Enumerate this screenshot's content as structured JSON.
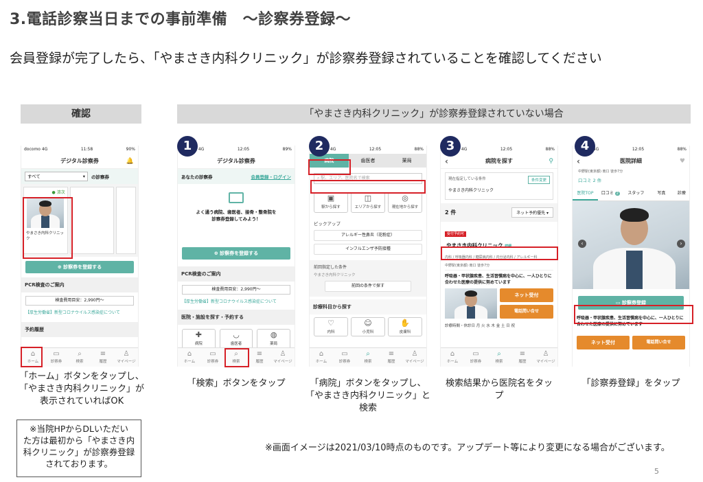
{
  "title": "3.電話診察当日までの事前準備　～診察券登録～",
  "subtitle": "会員登録が完了したら、「やまさき内科クリニック」が診察券登録されていることを確認してください",
  "bars": {
    "confirm": "確認",
    "not_registered": "「やまさき内科クリニック」が診察券登録されていない場合"
  },
  "badges": [
    "1",
    "2",
    "3",
    "4"
  ],
  "phone0": {
    "status_left": "docomo 4G",
    "status_time": "11:58",
    "status_right": "90%",
    "header": "デジタル診察券",
    "filter_value": "すべて",
    "filter_suffix": "の診察券",
    "card_status": "● 済次",
    "card_clinic": "やまさき内科クリニック",
    "register_btn": "⊕ 診察券を登録する",
    "pcr_title": "PCR検査のご案内",
    "pcr_price": "検査費用目安：2,990円～",
    "pcr_link": "【厚生労働省】新型コロナウイルス感染症について",
    "history": "予約履歴"
  },
  "phone1": {
    "status_left": "docomo 4G",
    "status_time": "12:05",
    "status_right": "89%",
    "header": "デジタル診察券",
    "section": "あなたの診察券",
    "login_link": "会員登録・ログイン",
    "prompt": "よく通う病院、歯医者、接骨・整骨院を診察券登録してみよう！",
    "register_btn": "⊕ 診察券を登録する",
    "pcr_title": "PCR検査のご案内",
    "pcr_price": "検査費用目安：2,990円～",
    "pcr_link": "【厚生労働省】新型コロナウイルス感染症について",
    "search_section": "医院・施設を探す・予約する",
    "cat1": "病院",
    "cat2": "歯医者",
    "cat3": "薬局"
  },
  "phone2": {
    "status_left": "docomo 4G",
    "status_time": "12:05",
    "status_right": "88%",
    "tabs": [
      "病院",
      "歯医者",
      "薬局"
    ],
    "search_placeholder": "駅、エリア、医院名で検索",
    "btn_station": "駅から探す",
    "btn_area": "エリアから探す",
    "btn_current": "現在地から探す",
    "pickup": "ピックアップ",
    "pick1": "アレルギー性鼻炎（花粉症）",
    "pick2": "インフルエンザ予防接種",
    "prev_label": "前回指定した条件",
    "prev_value": "やまさき内科クリニック",
    "prev_btn": "前回の条件で探す",
    "dept_title": "診療科目から探す",
    "dept1": "内科",
    "dept2": "小児科",
    "dept3": "皮膚科"
  },
  "phone3": {
    "status_left": "docomo 4G",
    "status_time": "12:05",
    "status_right": "88%",
    "header": "病院を探す",
    "cond_label": "現在指定している条件",
    "cond_btn": "条件変更",
    "cond_value": "やまさき内科クリニック",
    "count": "2 件",
    "sort": "ネット予約優先",
    "tag": "受付予約可",
    "clinic": "やまさき内科クリニック",
    "clinic_detail": "詳細",
    "depts": "内科 / 呼吸器内科 / 糖尿病内科 / 内分泌内科 / アレルギー科",
    "location": "中野駅(東京都) 南口 徒歩7分",
    "desc": "呼吸器・甲状腺疾患、生活習慣病を中心に、一人ひとりに合わせた医療の提供に努めています",
    "net_btn": "ネット受付",
    "tel_btn": "電話問い合せ",
    "hours": "診療時間・休診日 月 火 水 木 金 土 日 祝"
  },
  "phone4": {
    "status_left": "docomo 4G",
    "status_time": "12:05",
    "status_right": "88%",
    "header": "医院詳細",
    "location": "中野駅(東京都) 南口 徒歩7分",
    "reviews": "口コミ 2 件",
    "tabs": [
      "医院TOP",
      "口コミ",
      "スタッフ",
      "写真",
      "診療"
    ],
    "register_btn": "診察券登録",
    "desc": "呼吸器・甲状腺疾患、生活習慣病を中心に、一人ひとりに合わせた医療の提供に努めています",
    "net_btn": "ネット受付",
    "tel_btn": "電話問い合せ",
    "reviews_count": "2"
  },
  "tabbar": [
    "ホーム",
    "診察券",
    "検索",
    "履歴",
    "マイページ"
  ],
  "captions": {
    "c0": [
      "「ホーム」ボタンをタップし、",
      "「やまさき内科クリニック」が",
      "表示されていればOK"
    ],
    "c1": [
      "「検索」ボタンをタップ"
    ],
    "c2": [
      "「病院」ボタンをタップし、",
      "「やまさき内科クリニック」と",
      "検索"
    ],
    "c3": [
      "検索結果から医院名をタッ",
      "プ"
    ],
    "c4": [
      "「診察券登録」をタップ"
    ]
  },
  "note": [
    "※当院HPからDLいただい",
    "た方は最初から「やまさき内",
    "科クリニック」が診察券登録",
    "されております。"
  ],
  "footnote": "※画面イメージは2021/03/10時点のものです。アップデート等により変更になる場合がございます。",
  "page_number": "5",
  "colors": {
    "teal": "#5fb3a5",
    "red_box": "#d61f26",
    "badge": "#1f2a60",
    "orange": "#e58a2c"
  }
}
